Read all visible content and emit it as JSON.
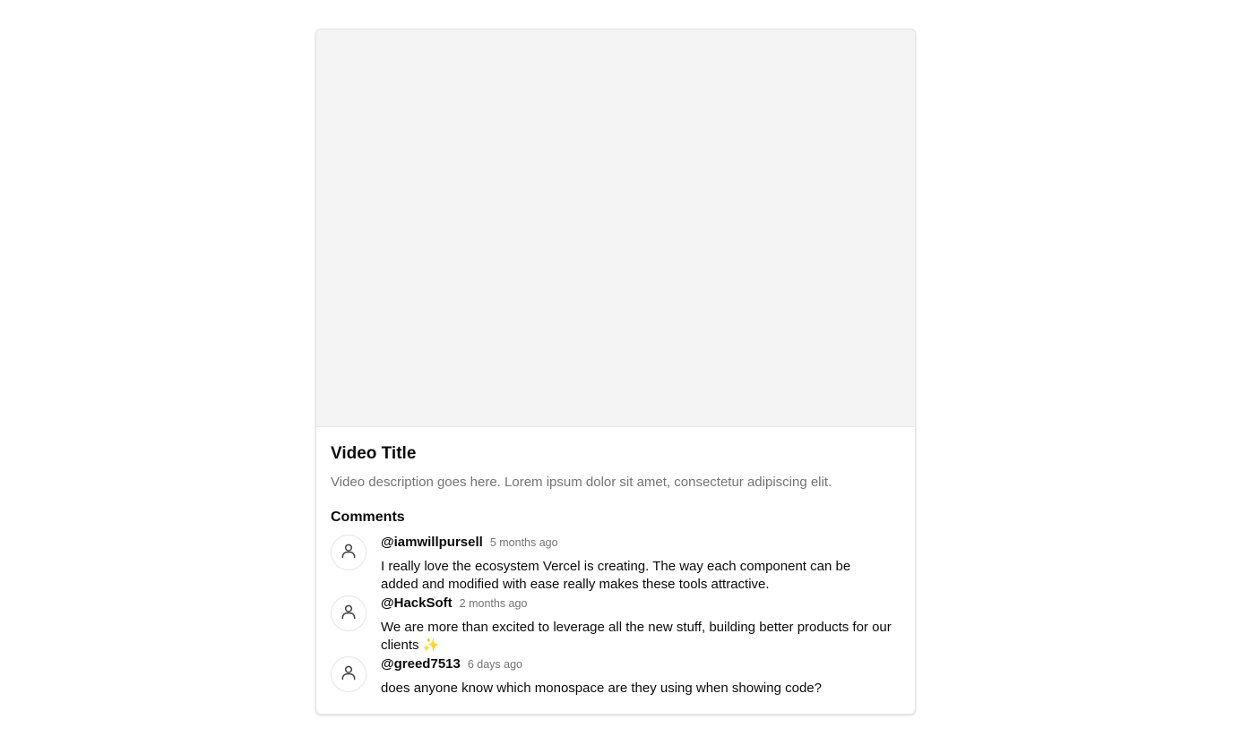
{
  "video": {
    "title": "Video Title",
    "description": "Video description goes here. Lorem ipsum dolor sit amet, consectetur adipiscing elit."
  },
  "comments": {
    "heading": "Comments",
    "items": [
      {
        "username": "@iamwillpursell",
        "time": "5 months ago",
        "text": "I really love the ecosystem Vercel is creating. The way each component can be added and modified with ease really makes these tools attractive."
      },
      {
        "username": "@HackSoft",
        "time": "2 months ago",
        "text": "We are more than excited to leverage all the new stuff, building better products for our clients ✨"
      },
      {
        "username": "@greed7513",
        "time": "6 days ago",
        "text": "does anyone know which monospace are they using when showing code?"
      }
    ]
  },
  "icons": {
    "avatar": "user-icon"
  },
  "colors": {
    "video_placeholder": "#f4f4f4",
    "muted_text": "#737373",
    "border": "#e5e5e5"
  }
}
